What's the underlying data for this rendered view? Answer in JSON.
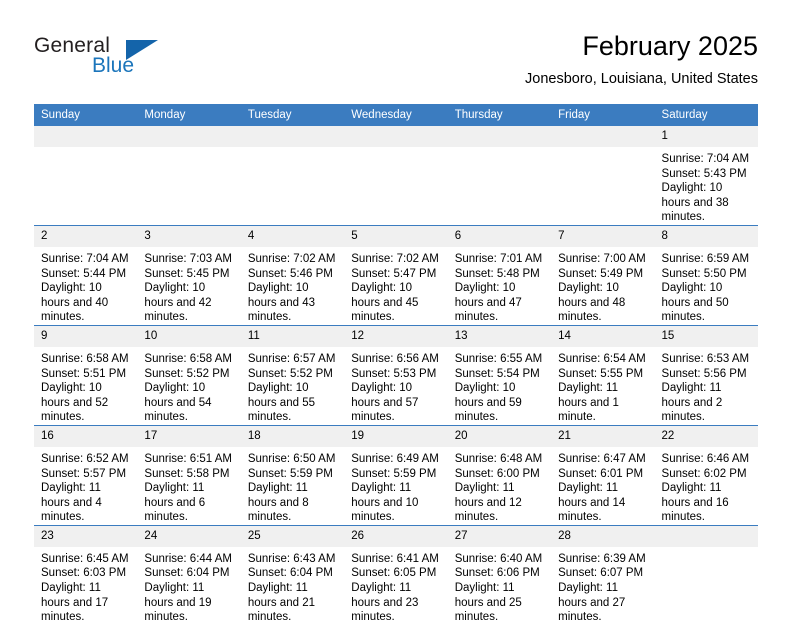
{
  "brand": {
    "name_top": "General",
    "name_bottom": "Blue",
    "triangle_color": "#1464aa",
    "blue_color": "#1b75bb"
  },
  "header": {
    "month_title": "February 2025",
    "location": "Jonesboro, Louisiana, United States"
  },
  "theme": {
    "header_bg": "#3b7cc0",
    "header_text": "#ffffff",
    "daynum_bg": "#f0f0f0",
    "grid_line": "#3b7cc0"
  },
  "weekday_headers": [
    "Sunday",
    "Monday",
    "Tuesday",
    "Wednesday",
    "Thursday",
    "Friday",
    "Saturday"
  ],
  "weeks": [
    [
      {
        "day": "",
        "empty": true
      },
      {
        "day": "",
        "empty": true
      },
      {
        "day": "",
        "empty": true
      },
      {
        "day": "",
        "empty": true
      },
      {
        "day": "",
        "empty": true
      },
      {
        "day": "",
        "empty": true
      },
      {
        "day": "1",
        "sunrise": "Sunrise: 7:04 AM",
        "sunset": "Sunset: 5:43 PM",
        "daylight": "Daylight: 10 hours and 38 minutes."
      }
    ],
    [
      {
        "day": "2",
        "sunrise": "Sunrise: 7:04 AM",
        "sunset": "Sunset: 5:44 PM",
        "daylight": "Daylight: 10 hours and 40 minutes."
      },
      {
        "day": "3",
        "sunrise": "Sunrise: 7:03 AM",
        "sunset": "Sunset: 5:45 PM",
        "daylight": "Daylight: 10 hours and 42 minutes."
      },
      {
        "day": "4",
        "sunrise": "Sunrise: 7:02 AM",
        "sunset": "Sunset: 5:46 PM",
        "daylight": "Daylight: 10 hours and 43 minutes."
      },
      {
        "day": "5",
        "sunrise": "Sunrise: 7:02 AM",
        "sunset": "Sunset: 5:47 PM",
        "daylight": "Daylight: 10 hours and 45 minutes."
      },
      {
        "day": "6",
        "sunrise": "Sunrise: 7:01 AM",
        "sunset": "Sunset: 5:48 PM",
        "daylight": "Daylight: 10 hours and 47 minutes."
      },
      {
        "day": "7",
        "sunrise": "Sunrise: 7:00 AM",
        "sunset": "Sunset: 5:49 PM",
        "daylight": "Daylight: 10 hours and 48 minutes."
      },
      {
        "day": "8",
        "sunrise": "Sunrise: 6:59 AM",
        "sunset": "Sunset: 5:50 PM",
        "daylight": "Daylight: 10 hours and 50 minutes."
      }
    ],
    [
      {
        "day": "9",
        "sunrise": "Sunrise: 6:58 AM",
        "sunset": "Sunset: 5:51 PM",
        "daylight": "Daylight: 10 hours and 52 minutes."
      },
      {
        "day": "10",
        "sunrise": "Sunrise: 6:58 AM",
        "sunset": "Sunset: 5:52 PM",
        "daylight": "Daylight: 10 hours and 54 minutes."
      },
      {
        "day": "11",
        "sunrise": "Sunrise: 6:57 AM",
        "sunset": "Sunset: 5:52 PM",
        "daylight": "Daylight: 10 hours and 55 minutes."
      },
      {
        "day": "12",
        "sunrise": "Sunrise: 6:56 AM",
        "sunset": "Sunset: 5:53 PM",
        "daylight": "Daylight: 10 hours and 57 minutes."
      },
      {
        "day": "13",
        "sunrise": "Sunrise: 6:55 AM",
        "sunset": "Sunset: 5:54 PM",
        "daylight": "Daylight: 10 hours and 59 minutes."
      },
      {
        "day": "14",
        "sunrise": "Sunrise: 6:54 AM",
        "sunset": "Sunset: 5:55 PM",
        "daylight": "Daylight: 11 hours and 1 minute."
      },
      {
        "day": "15",
        "sunrise": "Sunrise: 6:53 AM",
        "sunset": "Sunset: 5:56 PM",
        "daylight": "Daylight: 11 hours and 2 minutes."
      }
    ],
    [
      {
        "day": "16",
        "sunrise": "Sunrise: 6:52 AM",
        "sunset": "Sunset: 5:57 PM",
        "daylight": "Daylight: 11 hours and 4 minutes."
      },
      {
        "day": "17",
        "sunrise": "Sunrise: 6:51 AM",
        "sunset": "Sunset: 5:58 PM",
        "daylight": "Daylight: 11 hours and 6 minutes."
      },
      {
        "day": "18",
        "sunrise": "Sunrise: 6:50 AM",
        "sunset": "Sunset: 5:59 PM",
        "daylight": "Daylight: 11 hours and 8 minutes."
      },
      {
        "day": "19",
        "sunrise": "Sunrise: 6:49 AM",
        "sunset": "Sunset: 5:59 PM",
        "daylight": "Daylight: 11 hours and 10 minutes."
      },
      {
        "day": "20",
        "sunrise": "Sunrise: 6:48 AM",
        "sunset": "Sunset: 6:00 PM",
        "daylight": "Daylight: 11 hours and 12 minutes."
      },
      {
        "day": "21",
        "sunrise": "Sunrise: 6:47 AM",
        "sunset": "Sunset: 6:01 PM",
        "daylight": "Daylight: 11 hours and 14 minutes."
      },
      {
        "day": "22",
        "sunrise": "Sunrise: 6:46 AM",
        "sunset": "Sunset: 6:02 PM",
        "daylight": "Daylight: 11 hours and 16 minutes."
      }
    ],
    [
      {
        "day": "23",
        "sunrise": "Sunrise: 6:45 AM",
        "sunset": "Sunset: 6:03 PM",
        "daylight": "Daylight: 11 hours and 17 minutes."
      },
      {
        "day": "24",
        "sunrise": "Sunrise: 6:44 AM",
        "sunset": "Sunset: 6:04 PM",
        "daylight": "Daylight: 11 hours and 19 minutes."
      },
      {
        "day": "25",
        "sunrise": "Sunrise: 6:43 AM",
        "sunset": "Sunset: 6:04 PM",
        "daylight": "Daylight: 11 hours and 21 minutes."
      },
      {
        "day": "26",
        "sunrise": "Sunrise: 6:41 AM",
        "sunset": "Sunset: 6:05 PM",
        "daylight": "Daylight: 11 hours and 23 minutes."
      },
      {
        "day": "27",
        "sunrise": "Sunrise: 6:40 AM",
        "sunset": "Sunset: 6:06 PM",
        "daylight": "Daylight: 11 hours and 25 minutes."
      },
      {
        "day": "28",
        "sunrise": "Sunrise: 6:39 AM",
        "sunset": "Sunset: 6:07 PM",
        "daylight": "Daylight: 11 hours and 27 minutes."
      },
      {
        "day": "",
        "empty": true
      }
    ]
  ]
}
